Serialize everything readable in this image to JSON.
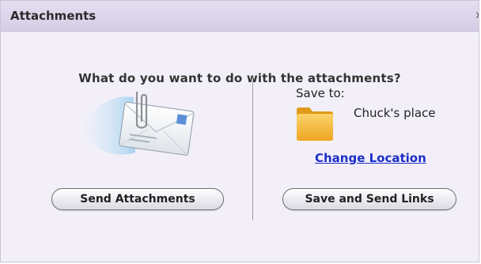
{
  "dialog": {
    "title": "Attachments",
    "close_label": "x"
  },
  "main": {
    "question": "What do you want to do with the attachments?"
  },
  "left": {
    "illustration_icon": "envelope-with-paperclip-icon",
    "send_button_label": "Send Attachments"
  },
  "right": {
    "save_to_label": "Save to:",
    "location_name": "Chuck's place",
    "folder_icon": "folder-icon",
    "change_location_link": "Change Location",
    "save_button_label": "Save and Send Links"
  },
  "colors": {
    "dialog_background": "#f3eff8",
    "titlebar": "#d6cde6",
    "link": "#1c2fc9",
    "folder": "#f2b12c"
  }
}
